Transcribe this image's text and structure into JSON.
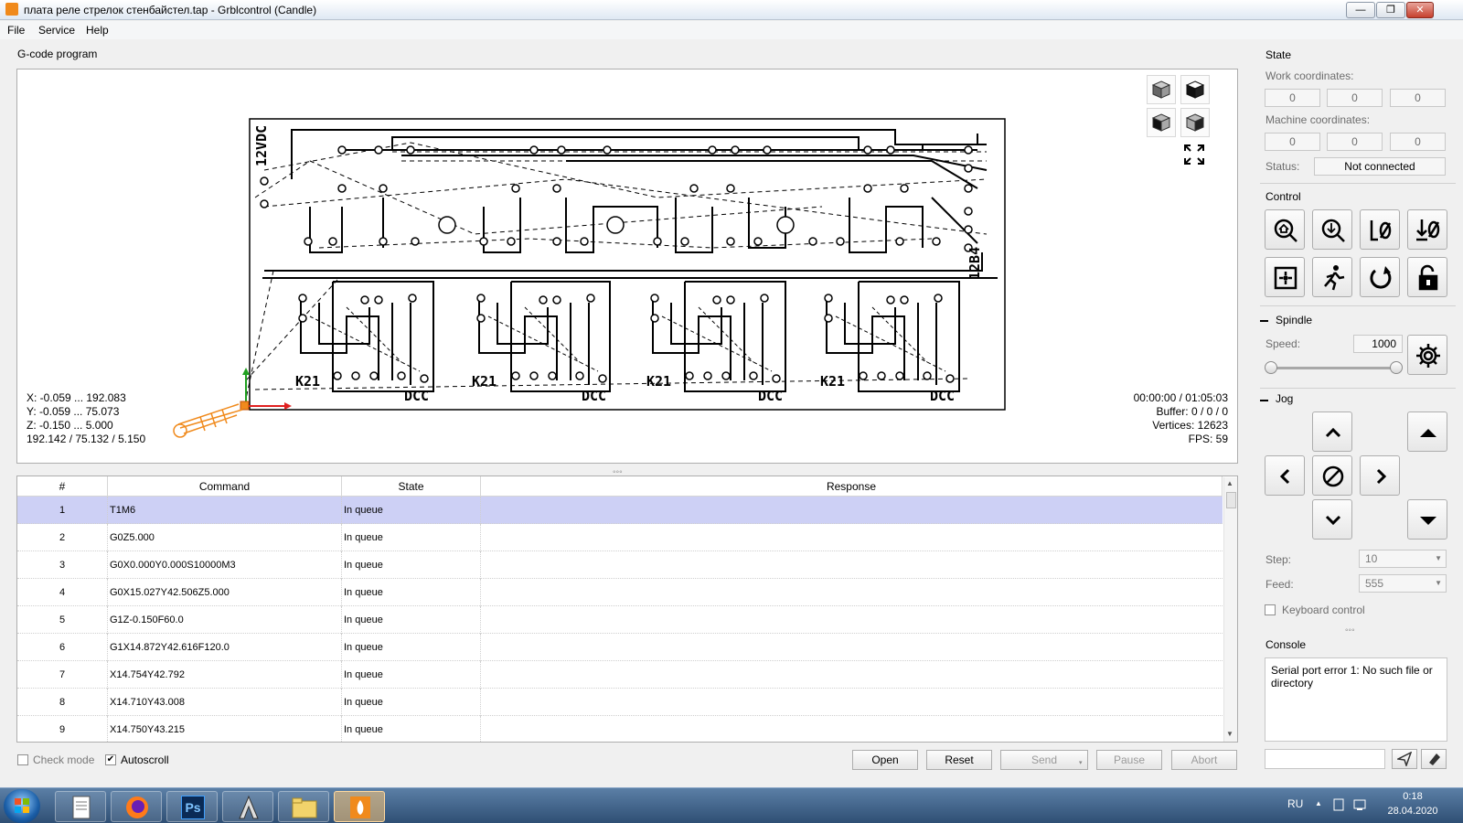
{
  "window": {
    "title": "плата реле стрелок стенбайстел.tap - Grblcontrol  (Candle)",
    "controls": {
      "minimize": "—",
      "maximize": "❐",
      "close": "✕"
    }
  },
  "menu": [
    "File",
    "Service",
    "Help"
  ],
  "gcode": {
    "label": "G-code program",
    "ranges": {
      "x": "X: -0.059 ... 192.083",
      "y": "Y: -0.059 ... 75.073",
      "z": "Z: -0.150 ... 5.000",
      "size": "192.142 / 75.132 / 5.150"
    },
    "stats": {
      "time": "00:00:00 / 01:05:03",
      "buffer": "Buffer: 0 / 0 / 0",
      "vertices": "Vertices: 12623",
      "fps": "FPS: 59"
    },
    "pcb_labels": {
      "left_vertical": "12VDC",
      "right_vertical": "12B4",
      "relay_a": "K21",
      "relay_b": "DCC"
    }
  },
  "table": {
    "headers": [
      "#",
      "Command",
      "State",
      "Response"
    ],
    "rows": [
      {
        "n": "1",
        "cmd": "T1M6",
        "state": "In queue",
        "resp": ""
      },
      {
        "n": "2",
        "cmd": "G0Z5.000",
        "state": "In queue",
        "resp": ""
      },
      {
        "n": "3",
        "cmd": "G0X0.000Y0.000S10000M3",
        "state": "In queue",
        "resp": ""
      },
      {
        "n": "4",
        "cmd": "G0X15.027Y42.506Z5.000",
        "state": "In queue",
        "resp": ""
      },
      {
        "n": "5",
        "cmd": "G1Z-0.150F60.0",
        "state": "In queue",
        "resp": ""
      },
      {
        "n": "6",
        "cmd": "G1X14.872Y42.616F120.0",
        "state": "In queue",
        "resp": ""
      },
      {
        "n": "7",
        "cmd": "X14.754Y42.792",
        "state": "In queue",
        "resp": ""
      },
      {
        "n": "8",
        "cmd": "X14.710Y43.008",
        "state": "In queue",
        "resp": ""
      },
      {
        "n": "9",
        "cmd": "X14.750Y43.215",
        "state": "In queue",
        "resp": ""
      }
    ]
  },
  "bottom": {
    "check_mode": "Check mode",
    "autoscroll": "Autoscroll",
    "autoscroll_checked": "✔",
    "buttons": {
      "open": "Open",
      "reset": "Reset",
      "send": "Send",
      "pause": "Pause",
      "abort": "Abort"
    }
  },
  "state": {
    "label": "State",
    "work_label": "Work coordinates:",
    "work": [
      "0",
      "0",
      "0"
    ],
    "machine_label": "Machine coordinates:",
    "machine": [
      "0",
      "0",
      "0"
    ],
    "status_label": "Status:",
    "status": "Not connected"
  },
  "control": {
    "label": "Control"
  },
  "spindle": {
    "label": "Spindle",
    "speed_label": "Speed:",
    "speed": "1000"
  },
  "jog": {
    "label": "Jog",
    "step_label": "Step:",
    "step": "10",
    "feed_label": "Feed:",
    "feed": "555",
    "keyboard": "Keyboard control"
  },
  "console": {
    "label": "Console",
    "text": "Serial port error 1: No such file or directory"
  },
  "taskbar": {
    "lang": "RU",
    "time": "0:18",
    "date": "28.04.2020",
    "apps": [
      "start",
      "notepad",
      "firefox",
      "photoshop",
      "autocad",
      "explorer",
      "candle"
    ],
    "ps_label": "Ps"
  },
  "colors": {
    "selected_row": "#cdd0f5",
    "accent": "#f08a1c",
    "taskbar": "#2f4f74"
  }
}
